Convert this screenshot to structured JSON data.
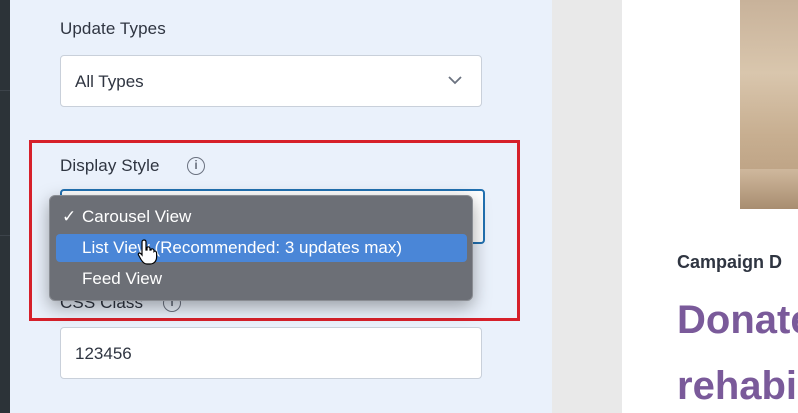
{
  "settings": {
    "update_types": {
      "label": "Update Types",
      "value": "All Types"
    },
    "display_style": {
      "label": "Display Style",
      "info_icon": "info-icon",
      "options": [
        {
          "label": "Carousel View",
          "checked": true
        },
        {
          "label": "List View (Recommended: 3 updates max)",
          "highlighted": true
        },
        {
          "label": "Feed View"
        }
      ]
    },
    "css_class": {
      "label": "CSS Class",
      "value": "123456"
    }
  },
  "preview": {
    "campaign_label": "Campaign D",
    "headline_line1": "Donate",
    "headline_line2": "rehabi"
  },
  "colors": {
    "panel_bg": "#eaf1fb",
    "highlight_frame": "#d6202a",
    "dropdown_bg": "#6c6f76",
    "selected_option": "#4a86d7",
    "headline": "#7a5a9a"
  }
}
